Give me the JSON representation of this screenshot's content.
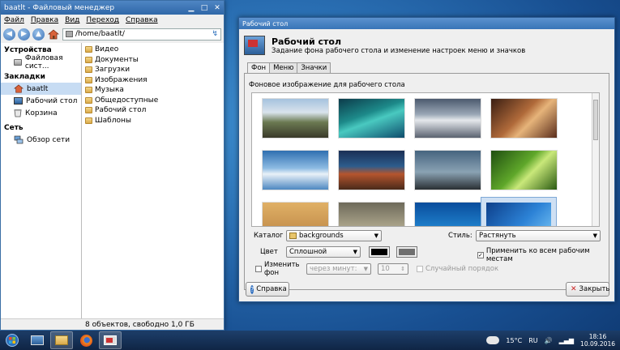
{
  "file_manager": {
    "title": "baatlt - Файловый менеджер",
    "menu": [
      "Файл",
      "Правка",
      "Вид",
      "Переход",
      "Справка"
    ],
    "address": "/home/baatlt/",
    "sections": [
      {
        "label": "Устройства",
        "items": [
          {
            "label": "Файловая сист...",
            "icon": "drive-icon"
          }
        ]
      },
      {
        "label": "Закладки",
        "items": [
          {
            "label": "baatlt",
            "icon": "home-icon",
            "selected": true
          },
          {
            "label": "Рабочий стол",
            "icon": "desktop-icon"
          },
          {
            "label": "Корзина",
            "icon": "trash-icon"
          }
        ]
      },
      {
        "label": "Сеть",
        "items": [
          {
            "label": "Обзор сети",
            "icon": "network-icon"
          }
        ]
      }
    ],
    "folders": [
      "Видео",
      "Документы",
      "Загрузки",
      "Изображения",
      "Музыка",
      "Общедоступные",
      "Рабочий стол",
      "Шаблоны"
    ],
    "status": "8 объектов, свободно 1,0 ГБ"
  },
  "dialog": {
    "window_title": "Рабочий стол",
    "heading": "Рабочий стол",
    "subheading": "Задание фона рабочего стола и изменение настроек меню и значков",
    "tabs": [
      "Фон",
      "Меню",
      "Значки"
    ],
    "active_tab": "Фон",
    "background_label": "Фоновое изображение для рабочего стола",
    "catalog_label": "Каталог",
    "catalog_value": "backgrounds",
    "style_label": "Стиль:",
    "style_value": "Растянуть",
    "color_label": "Цвет",
    "color_value": "Сплошной",
    "color1": "#000000",
    "color2": "#6f6f6f",
    "apply_all_label": "Применить ко всем рабочим местам",
    "apply_all_checked": true,
    "change_bg_label": "Изменить фон",
    "interval_value": "через минут:",
    "interval_number": "10",
    "random_label": "Случайный порядок",
    "help_button": "Справка",
    "close_button": "Закрыть"
  },
  "taskbar": {
    "temperature": "15°C",
    "language": "RU",
    "time": "18:16",
    "date": "10.09.2016"
  }
}
